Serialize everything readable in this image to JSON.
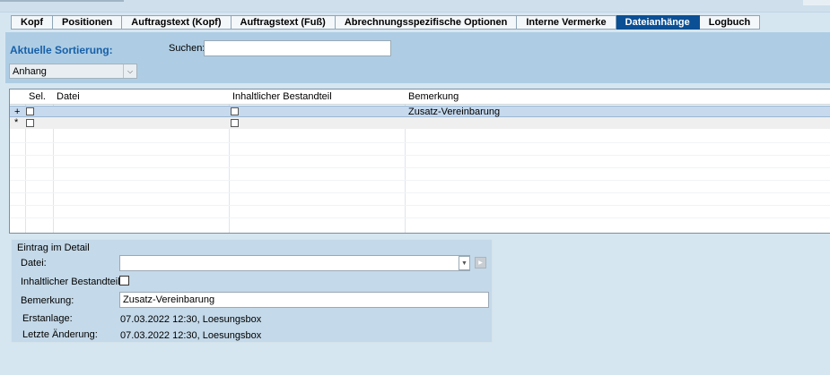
{
  "tabs": [
    {
      "label": "Kopf",
      "active": false
    },
    {
      "label": "Positionen",
      "active": false
    },
    {
      "label": "Auftragstext (Kopf)",
      "active": false
    },
    {
      "label": "Auftragstext (Fuß)",
      "active": false
    },
    {
      "label": "Abrechnungsspezifische Optionen",
      "active": false
    },
    {
      "label": "Interne Vermerke",
      "active": false
    },
    {
      "label": "Dateianhänge",
      "active": true
    },
    {
      "label": "Logbuch",
      "active": false
    }
  ],
  "header": {
    "sort_label": "Aktuelle Sortierung:",
    "sort_value": "Anhang",
    "search_label": "Suchen:",
    "search_value": ""
  },
  "grid": {
    "columns": [
      "Sel.",
      "Datei",
      "Inhaltlicher Bestandteil",
      "Bemerkung"
    ],
    "rows": [
      {
        "marker": "+",
        "sel": false,
        "datei": "",
        "inhaltlich": false,
        "bemerkung": "Zusatz-Vereinbarung"
      },
      {
        "marker": "*",
        "sel": false,
        "datei": "",
        "inhaltlich": false,
        "bemerkung": ""
      }
    ]
  },
  "detail": {
    "title": "Eintrag im Detail",
    "datei_label": "Datei:",
    "datei_value": "",
    "inhaltlich_label": "Inhaltlicher Bestandteil:",
    "bemerkung_label": "Bemerkung:",
    "bemerkung_value": "Zusatz-Vereinbarung",
    "erstanlage_label": "Erstanlage:",
    "erstanlage_value": "07.03.2022 12:30, Loesungsbox",
    "aenderung_label": "Letzte Änderung:",
    "aenderung_value": "07.03.2022 12:30, Loesungsbox"
  },
  "colors": {
    "active_tab": "#0b4f94",
    "selected_row": "#c6d9ed",
    "header_panel": "#aecde4",
    "sort_label": "#1760a8"
  }
}
